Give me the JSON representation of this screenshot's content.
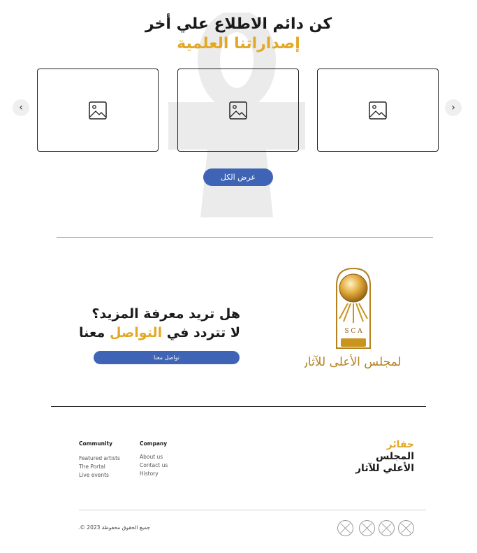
{
  "hero": {
    "title_line1": "كن دائم الاطلاع علي أخر",
    "title_line2": "إصداراتنا العلمية"
  },
  "carousel": {
    "cards": [
      {
        "icon": "image-placeholder-icon"
      },
      {
        "icon": "image-placeholder-icon"
      },
      {
        "icon": "image-placeholder-icon"
      }
    ],
    "prev_icon": "‹",
    "next_icon": "›",
    "view_all_label": "عرض الكل"
  },
  "cta": {
    "question": "هل تريد معرفة المزيد؟",
    "line2_part1": "لا تتردد في",
    "line2_highlight": "التواصل",
    "line2_part2": "معنا",
    "button_label": "تواصل معنا"
  },
  "logo": {
    "text": "المجلس الأعلى للآثار",
    "initials": "S C A"
  },
  "footer": {
    "community": {
      "heading": "Community",
      "items": [
        "Featured artists",
        "The Portal",
        "Live events"
      ]
    },
    "company": {
      "heading": "Company",
      "items": [
        "About us",
        "Contact us",
        "History"
      ]
    },
    "brand_line1": "حفائر",
    "brand_line2": "المجلس",
    "brand_line3": "الأعلي للآثار",
    "copyright": "جميع الحقوق محفوظة  2023 ©.",
    "social_icons": [
      "social-icon",
      "social-icon",
      "social-icon",
      "social-icon"
    ]
  },
  "colors": {
    "accent": "#E2A826",
    "button": "#3F64B5",
    "watermark": "#ebebeb"
  }
}
